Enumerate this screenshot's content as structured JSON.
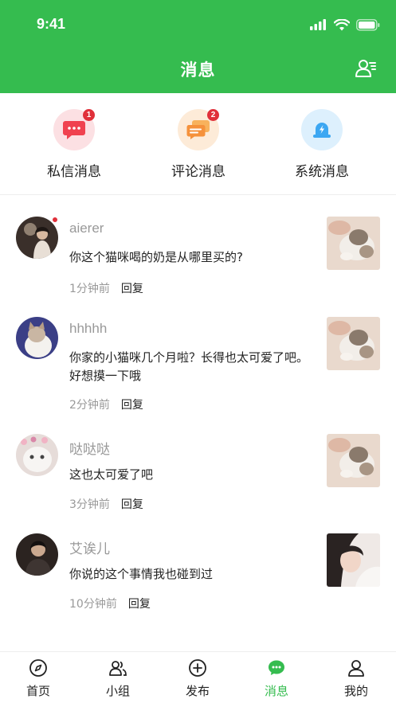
{
  "status_bar": {
    "time": "9:41"
  },
  "header": {
    "title": "消息"
  },
  "categories": [
    {
      "label": "私信消息",
      "badge": "1",
      "icon": "chat-bubble-icon",
      "color": "#F0414F"
    },
    {
      "label": "评论消息",
      "badge": "2",
      "icon": "comments-icon",
      "color": "#F5913B"
    },
    {
      "label": "系统消息",
      "badge": "",
      "icon": "bell-icon",
      "color": "#3CA7F2"
    }
  ],
  "messages": [
    {
      "name": "aierer",
      "text": "你这个猫咪喝的奶是从哪里买的?",
      "time": "1分钟前",
      "reply": "回复",
      "unread": true
    },
    {
      "name": "hhhhh",
      "text": "你家的小猫咪几个月啦？长得也太可爱了吧。好想摸一下哦",
      "time": "2分钟前",
      "reply": "回复",
      "unread": false
    },
    {
      "name": "哒哒哒",
      "text": "这也太可爱了吧",
      "time": "3分钟前",
      "reply": "回复",
      "unread": false
    },
    {
      "name": "艾诶儿",
      "text": "你说的这个事情我也碰到过",
      "time": "10分钟前",
      "reply": "回复",
      "unread": false
    }
  ],
  "tabbar": [
    {
      "label": "首页",
      "icon": "compass-icon",
      "active": false
    },
    {
      "label": "小组",
      "icon": "group-icon",
      "active": false
    },
    {
      "label": "发布",
      "icon": "plus-circle-icon",
      "active": false
    },
    {
      "label": "消息",
      "icon": "message-icon",
      "active": true
    },
    {
      "label": "我的",
      "icon": "user-icon",
      "active": false
    }
  ],
  "colors": {
    "brand": "#35BC4F",
    "badge": "#E0303A"
  }
}
